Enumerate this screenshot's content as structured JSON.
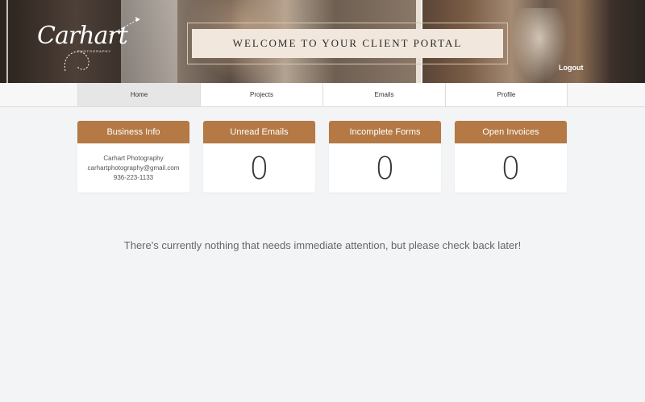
{
  "header": {
    "logo_text": "Carhart",
    "logo_subtext": "PHOTOGRAPHY",
    "welcome_banner": "WELCOME TO YOUR CLIENT PORTAL",
    "logout_label": "Logout"
  },
  "nav": {
    "tabs": [
      {
        "label": "Home",
        "active": true
      },
      {
        "label": "Projects",
        "active": false
      },
      {
        "label": "Emails",
        "active": false
      },
      {
        "label": "Profile",
        "active": false
      }
    ]
  },
  "cards": {
    "business_info": {
      "title": "Business Info",
      "name": "Carhart Photography",
      "email": "carhartphotography@gmail.com",
      "phone": "936-223-1133"
    },
    "unread_emails": {
      "title": "Unread Emails",
      "count": "0"
    },
    "incomplete_forms": {
      "title": "Incomplete Forms",
      "count": "0"
    },
    "open_invoices": {
      "title": "Open Invoices",
      "count": "0"
    }
  },
  "message": "There's currently nothing that needs immediate attention, but please check back later!",
  "colors": {
    "accent": "#b47944",
    "banner_bg": "#f1e7dc",
    "page_bg": "#f3f4f6"
  }
}
